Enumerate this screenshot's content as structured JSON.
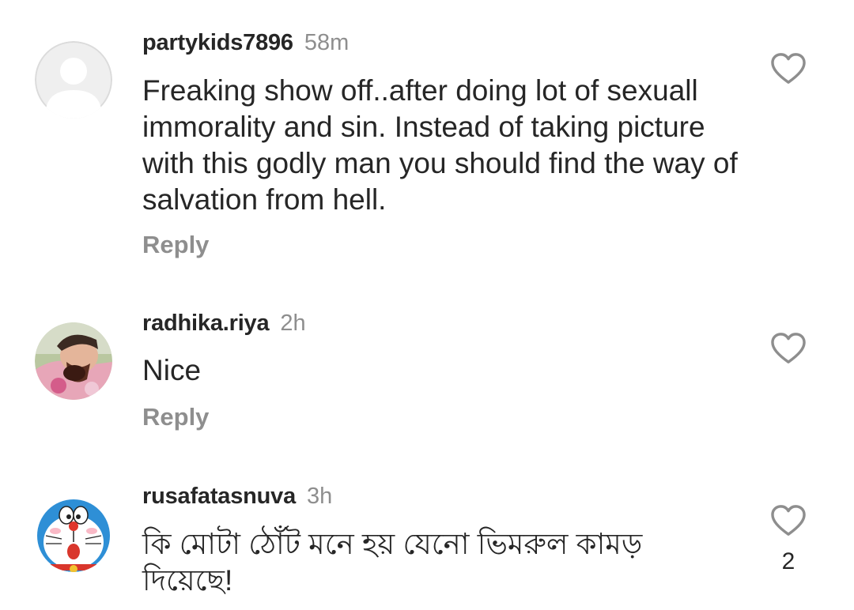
{
  "comments": [
    {
      "username": "partykids7896",
      "time": "58m",
      "text": "Freaking show off..after doing lot of sexuall immorality and sin. Instead of taking picture with this godly man you should find the way of salvation from hell.",
      "reply_label": "Reply",
      "avatar_icon": "default-profile-icon"
    },
    {
      "username": "radhika.riya",
      "time": "2h",
      "text": "Nice",
      "reply_label": "Reply",
      "avatar_icon": "profile-photo"
    },
    {
      "username": "rusafatasnuva",
      "time": "3h",
      "text": "কি মোটা ঠোঁট মনে হয় যেনো ভিমরুল কামড় দিয়েছে!",
      "like_count": "2",
      "avatar_icon": "doraemon-avatar"
    }
  ],
  "colors": {
    "text": "#262626",
    "secondary": "#8e8e8e",
    "background": "#ffffff",
    "heart_outline": "#8e8e8e"
  }
}
